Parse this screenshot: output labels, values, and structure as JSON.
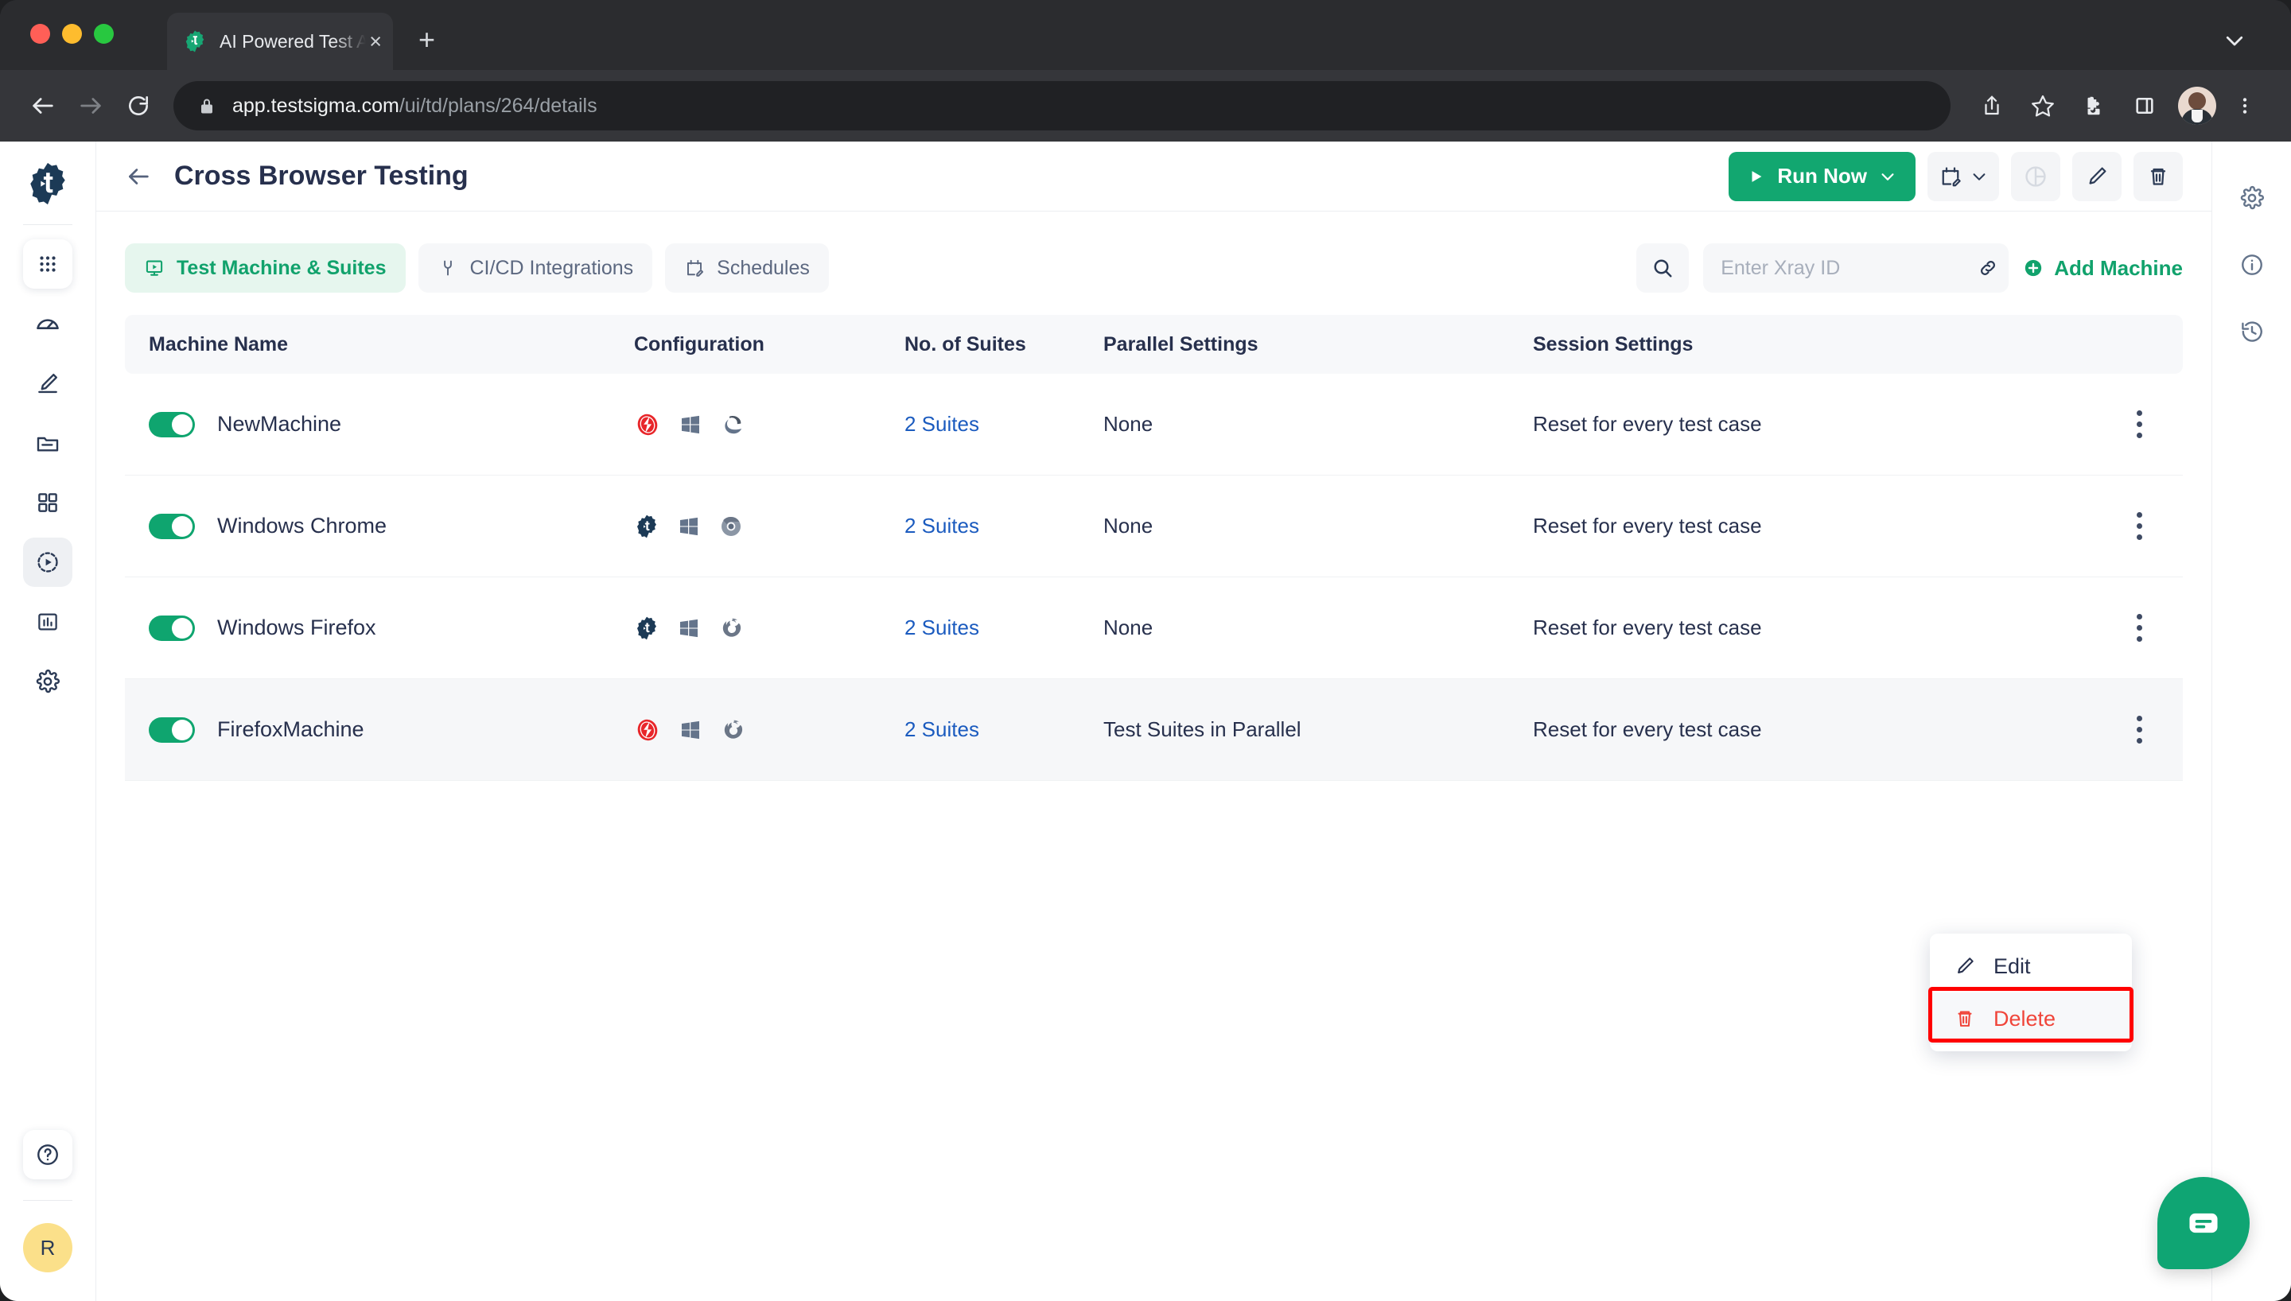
{
  "browser": {
    "tab": {
      "title": "AI Powered Test Automation P",
      "favicon": "testsigma-gear-icon",
      "close": "×"
    },
    "new_tab": "+",
    "url_domain": "app.testsigma.com",
    "url_path": "/ui/td/plans/264/details",
    "toolbar_icons": [
      "share-icon",
      "bookmark-star-icon",
      "extensions-puzzle-icon",
      "side-panel-icon",
      "profile-avatar",
      "chrome-menu-icon"
    ]
  },
  "left_sidebar": {
    "logo": "testsigma-logo",
    "items": [
      {
        "name": "apps-grid",
        "active": false,
        "card": true
      },
      {
        "name": "dashboard-gauge",
        "active": false
      },
      {
        "name": "create-pencil",
        "active": false
      },
      {
        "name": "folder",
        "active": false
      },
      {
        "name": "modules-grid",
        "active": false
      },
      {
        "name": "run-plans",
        "active": true
      },
      {
        "name": "reports-chart",
        "active": false
      },
      {
        "name": "settings-gear",
        "active": false
      }
    ],
    "help": "?",
    "user_initial": "R"
  },
  "header": {
    "back": "back-arrow",
    "title": "Cross Browser Testing",
    "run_now": "Run Now",
    "actions": [
      "schedule-icon",
      "chart-icon",
      "edit-pencil-icon",
      "delete-trash-icon"
    ]
  },
  "tabs": [
    {
      "label": "Test Machine & Suites",
      "icon": "monitor-play-icon",
      "active": true
    },
    {
      "label": "CI/CD Integrations",
      "icon": "plug-icon",
      "active": false
    },
    {
      "label": "Schedules",
      "icon": "calendar-edit-icon",
      "active": false
    }
  ],
  "search": {
    "icon": "search-icon",
    "xray_placeholder": "Enter Xray ID",
    "xray_value": "",
    "link_icon": "link-icon"
  },
  "add_machine": {
    "label": "Add Machine",
    "icon": "plus-circle-icon"
  },
  "table": {
    "headers": [
      "Machine Name",
      "Configuration",
      "No. of Suites",
      "Parallel Settings",
      "Session Settings"
    ],
    "rows": [
      {
        "enabled": true,
        "name": "NewMachine",
        "config": [
          "hybrid-red-icon",
          "windows-icon",
          "edge-icon"
        ],
        "suites": "2 Suites",
        "parallel": "None",
        "session": "Reset for every test case",
        "highlight": false
      },
      {
        "enabled": true,
        "name": "Windows Chrome",
        "config": [
          "testsigma-gear-icon",
          "windows-icon",
          "chrome-icon"
        ],
        "suites": "2 Suites",
        "parallel": "None",
        "session": "Reset for every test case",
        "highlight": false
      },
      {
        "enabled": true,
        "name": "Windows Firefox",
        "config": [
          "testsigma-gear-icon",
          "windows-icon",
          "firefox-icon"
        ],
        "suites": "2 Suites",
        "parallel": "None",
        "session": "Reset for every test case",
        "highlight": false
      },
      {
        "enabled": true,
        "name": "FirefoxMachine",
        "config": [
          "hybrid-red-icon",
          "windows-icon",
          "firefox-icon"
        ],
        "suites": "2 Suites",
        "parallel": "Test Suites in Parallel",
        "session": "Reset for every test case",
        "highlight": true
      }
    ]
  },
  "row_menu": {
    "edit": "Edit",
    "delete": "Delete",
    "highlighted_item": "Delete"
  },
  "right_sidebar": {
    "items": [
      "settings-gear-icon",
      "info-circle-icon",
      "history-clock-icon"
    ]
  },
  "chat": {
    "icon": "chat-bubble-icon"
  },
  "colors": {
    "accent_green": "#12a770",
    "title_navy": "#27304d",
    "link_blue": "#1b5bbf",
    "danger_red": "#f0453a",
    "highlight_red": "#ff0000",
    "avatar_yellow": "#fbe08a"
  }
}
